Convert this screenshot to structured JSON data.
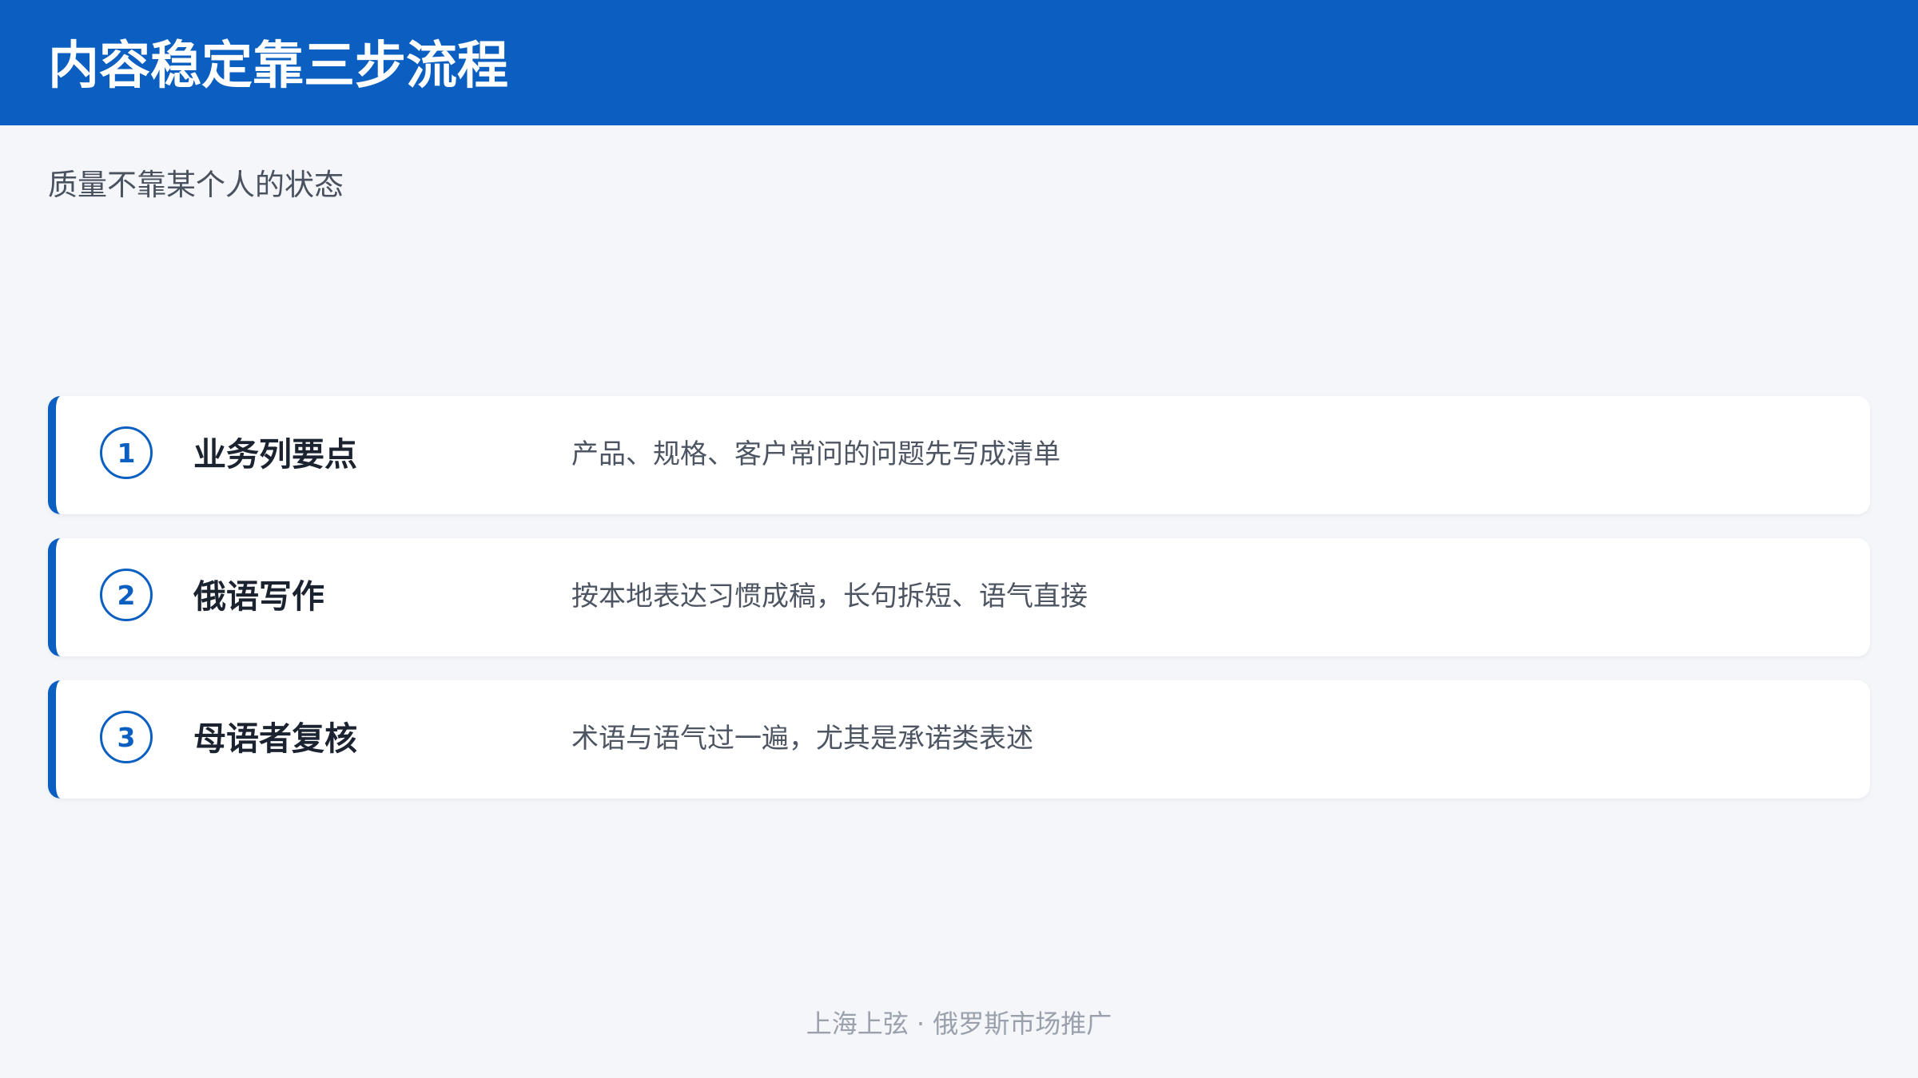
{
  "header": {
    "title": "内容稳定靠三步流程",
    "background_color": "#0b5fc0"
  },
  "subtitle": "质量不靠某个人的状态",
  "steps": [
    {
      "number": "1",
      "title": "业务列要点",
      "description": "产品、规格、客户常问的问题先写成清单"
    },
    {
      "number": "2",
      "title": "俄语写作",
      "description": "按本地表达习惯成稿，长句拆短、语气直接"
    },
    {
      "number": "3",
      "title": "母语者复核",
      "description": "术语与语气过一遍，尤其是承诺类表述"
    }
  ],
  "footer": "上海上弦 · 俄罗斯市场推广",
  "colors": {
    "accent": "#0b5fc0",
    "page_background": "#f4f6f9",
    "card_background": "#ffffff"
  }
}
